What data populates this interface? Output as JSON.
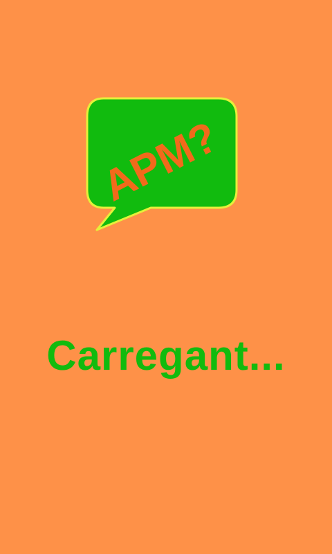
{
  "splash": {
    "logo_text": "APM?",
    "loading_text": "Carregant..."
  },
  "colors": {
    "background": "#FE9148",
    "bubble_fill": "#11BB0E",
    "bubble_border": "#E6F03A",
    "logo_text": "#F26A1B",
    "loading_text": "#11BB0E"
  },
  "icons": {
    "logo": "speech-bubble-icon"
  }
}
